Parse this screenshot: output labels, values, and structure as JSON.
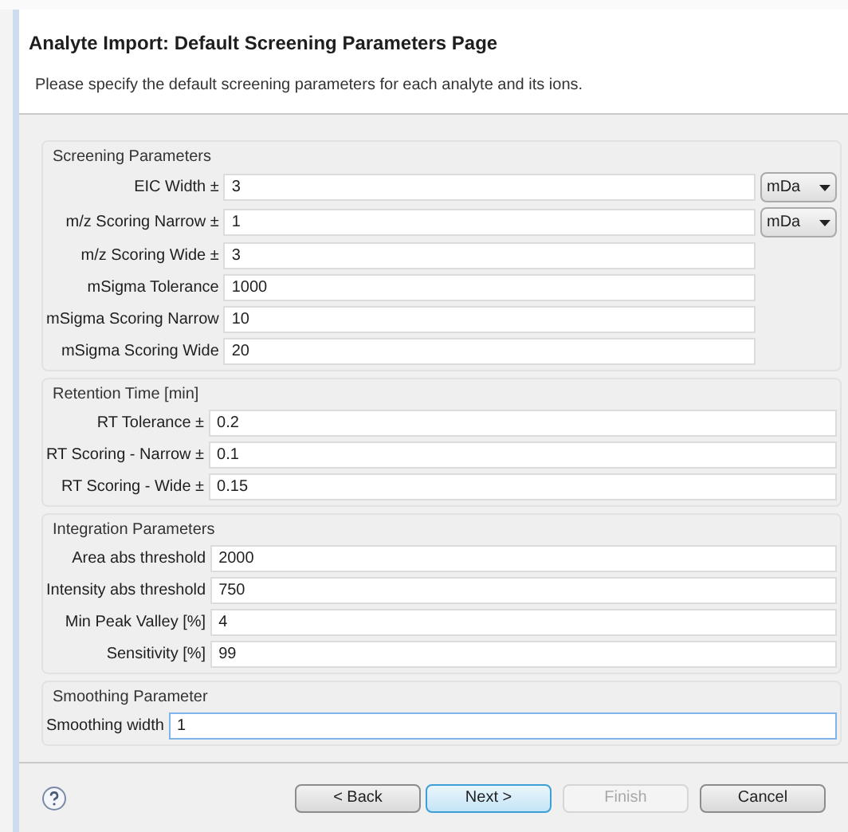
{
  "window": {
    "title": "Analyte Import: Default Screening Parameters Page",
    "description": "Please specify the default screening parameters for each analyte and its ions."
  },
  "groups": [
    {
      "title": "Screening Parameters",
      "rows": [
        {
          "label": "EIC Width ±",
          "value": "3",
          "unit": "mDa"
        },
        {
          "label": "m/z Scoring Narrow ±",
          "value": "1",
          "unit": "mDa"
        },
        {
          "label": "m/z Scoring Wide ±",
          "value": "3"
        },
        {
          "label": "mSigma Tolerance",
          "value": "1000"
        },
        {
          "label": "mSigma Scoring Narrow",
          "value": "10"
        },
        {
          "label": "mSigma Scoring Wide",
          "value": "20"
        }
      ]
    },
    {
      "title": "Retention Time [min]",
      "rows": [
        {
          "label": "RT Tolerance ±",
          "value": "0.2"
        },
        {
          "label": "RT Scoring - Narrow ±",
          "value": "0.1"
        },
        {
          "label": "RT Scoring - Wide ±",
          "value": "0.15"
        }
      ]
    },
    {
      "title": "Integration Parameters",
      "rows": [
        {
          "label": "Area abs threshold",
          "value": "2000"
        },
        {
          "label": "Intensity abs threshold",
          "value": "750"
        },
        {
          "label": "Min Peak Valley [%]",
          "value": "4"
        },
        {
          "label": "Sensitivity [%]",
          "value": "99"
        }
      ]
    },
    {
      "title": "Smoothing Parameter",
      "rows": [
        {
          "label": "Smoothing width",
          "value": "1",
          "focused": true
        }
      ]
    }
  ],
  "buttons": [
    {
      "label": "< Back",
      "disabled": false,
      "default": false
    },
    {
      "label": "Next >",
      "disabled": false,
      "default": true
    },
    {
      "label": "Finish",
      "disabled": true,
      "default": false
    },
    {
      "label": "Cancel",
      "disabled": false,
      "default": false
    }
  ]
}
